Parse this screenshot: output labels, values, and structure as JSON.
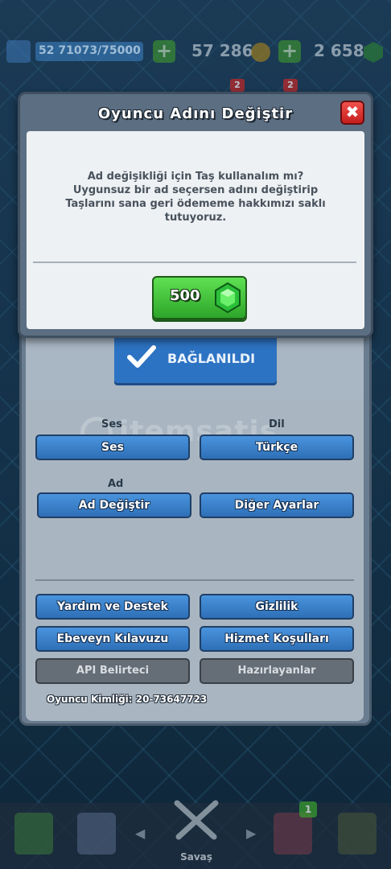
{
  "topbar": {
    "xp": "71073/75000",
    "level": "52",
    "gold": "57 286",
    "gems": "2 658",
    "plus": "+"
  },
  "badges": {
    "a": "2",
    "b": "2",
    "chest_count": "1"
  },
  "modal": {
    "title": "Oyuncu Adını Değiştir",
    "close": "✖",
    "message_lines": [
      "Ad değişikliği için Taş kullanalım mı?",
      "Uygunsuz bir ad seçersen adını değiştirip",
      "Taşlarını sana geri ödememe hakkımızı saklı",
      "tutuyoruz."
    ],
    "price": "500"
  },
  "settings": {
    "connected_label": "BAĞLANILDI",
    "sound_header": "Ses",
    "sound_button": "Ses",
    "language_header": "Dil",
    "language_button": "Türkçe",
    "name_header": "Ad",
    "change_name_button": "Ad Değiştir",
    "other_settings_button": "Diğer Ayarlar",
    "help_button": "Yardım ve Destek",
    "privacy_button": "Gizlilik",
    "parent_guide_button": "Ebeveyn Kılavuzu",
    "terms_button": "Hizmet Koşulları",
    "api_button": "API Belirteci",
    "credits_button": "Hazırlayanlar",
    "player_id": "Oyuncu Kimliği: 20-73647723"
  },
  "watermark": "itemsatis",
  "bottom_nav": {
    "battle_label": "Savaş",
    "left_arrow": "◀",
    "right_arrow": "▶"
  },
  "colors": {
    "primary_blue": "#2e6fb6",
    "green": "#3fb52f",
    "close_red": "#d32626"
  }
}
